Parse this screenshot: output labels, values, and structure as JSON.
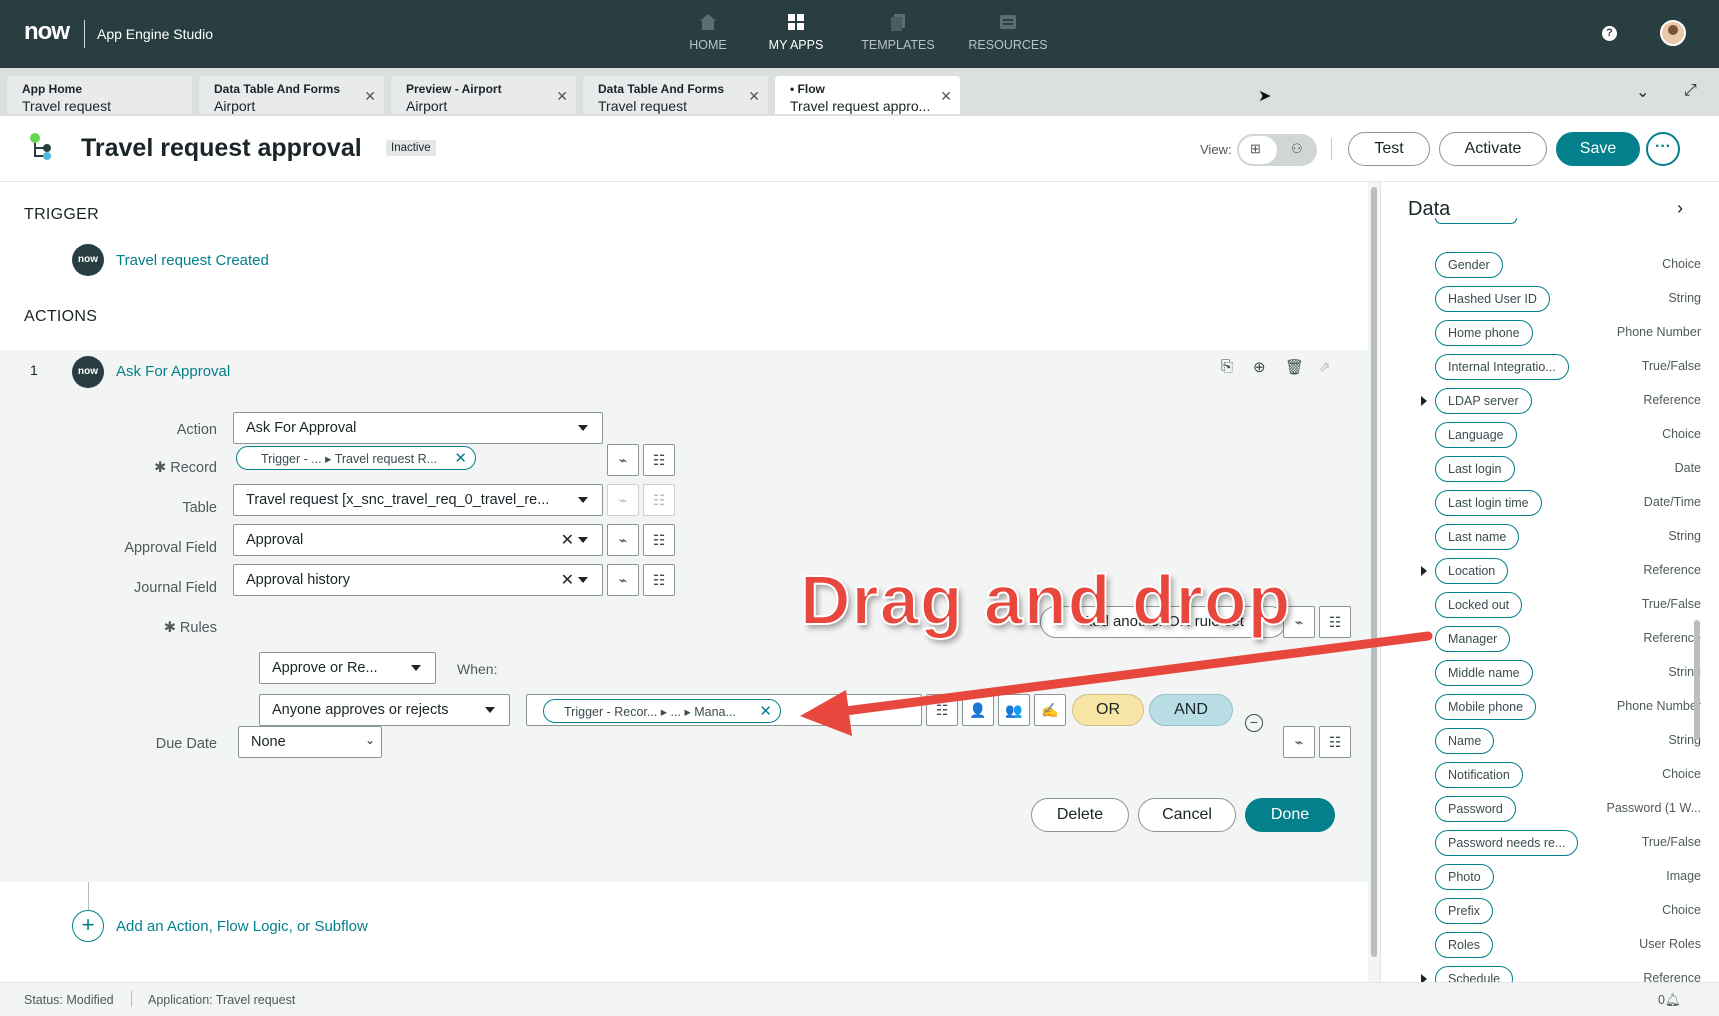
{
  "topnav": {
    "logo": "now",
    "app_title": "App Engine Studio",
    "items": [
      {
        "label": "HOME",
        "icon": "home-icon"
      },
      {
        "label": "MY APPS",
        "icon": "grid-icon"
      },
      {
        "label": "TEMPLATES",
        "icon": "templates-icon"
      },
      {
        "label": "RESOURCES",
        "icon": "resources-icon"
      }
    ],
    "active": "MY APPS",
    "help_glyph": "?"
  },
  "tabs": [
    {
      "line1": "App Home",
      "line2": "Travel request",
      "closable": false
    },
    {
      "line1": "Data Table And Forms",
      "line2": "Airport",
      "closable": true
    },
    {
      "line1": "Preview - Airport",
      "line2": "Airport",
      "closable": true
    },
    {
      "line1": "Data Table And Forms",
      "line2": "Travel request",
      "closable": true
    },
    {
      "line1": "• Flow",
      "line2": "Travel request appro...",
      "closable": true,
      "active": true
    }
  ],
  "header": {
    "title": "Travel request approval",
    "status": "Inactive",
    "view_label": "View:",
    "test_label": "Test",
    "activate_label": "Activate",
    "save_label": "Save",
    "more_label": "···"
  },
  "trigger": {
    "heading": "TRIGGER",
    "badge": "now",
    "label": "Travel request Created"
  },
  "actions": {
    "heading": "ACTIONS",
    "number": "1",
    "badge": "now",
    "title": "Ask For Approval",
    "fields": {
      "action_label": "Action",
      "action_value": "Ask For Approval",
      "record_label": "✱ Record",
      "record_pill_a": "Trigger - ...",
      "record_pill_b": "Travel request R...",
      "table_label": "Table",
      "table_value": "Travel request [x_snc_travel_req_0_travel_re...",
      "approval_field_label": "Approval Field",
      "approval_field_value": "Approval",
      "journal_field_label": "Journal Field",
      "journal_field_value": "Approval history",
      "rules_label": "✱ Rules",
      "rule_type": "Approve or Re...",
      "when_label": "When:",
      "rule_condition": "Anyone approves or rejects",
      "rule_pill_a": "Trigger - Recor...",
      "rule_pill_b": "...",
      "rule_pill_c": "Mana...",
      "or_label": "OR",
      "and_label": "AND",
      "add_or_rule_set": "Add another OR rule set",
      "due_date_label": "Due Date",
      "due_date_value": "None"
    },
    "buttons": {
      "delete": "Delete",
      "cancel": "Cancel",
      "done": "Done"
    },
    "add_action_label": "Add an Action, Flow Logic, or Subflow"
  },
  "data_panel": {
    "title": "Data",
    "items": [
      {
        "name": "Gender",
        "type": "Choice",
        "expandable": false
      },
      {
        "name": "Hashed User ID",
        "type": "String",
        "expandable": false
      },
      {
        "name": "Home phone",
        "type": "Phone Number",
        "expandable": false
      },
      {
        "name": "Internal Integratio...",
        "type": "True/False",
        "expandable": false
      },
      {
        "name": "LDAP server",
        "type": "Reference",
        "expandable": true
      },
      {
        "name": "Language",
        "type": "Choice",
        "expandable": false
      },
      {
        "name": "Last login",
        "type": "Date",
        "expandable": false
      },
      {
        "name": "Last login time",
        "type": "Date/Time",
        "expandable": false
      },
      {
        "name": "Last name",
        "type": "String",
        "expandable": false
      },
      {
        "name": "Location",
        "type": "Reference",
        "expandable": true
      },
      {
        "name": "Locked out",
        "type": "True/False",
        "expandable": false
      },
      {
        "name": "Manager",
        "type": "Reference",
        "expandable": false
      },
      {
        "name": "Middle name",
        "type": "String",
        "expandable": false
      },
      {
        "name": "Mobile phone",
        "type": "Phone Number",
        "expandable": false
      },
      {
        "name": "Name",
        "type": "String",
        "expandable": false
      },
      {
        "name": "Notification",
        "type": "Choice",
        "expandable": false
      },
      {
        "name": "Password",
        "type": "Password (1 W...",
        "expandable": false
      },
      {
        "name": "Password needs re...",
        "type": "True/False",
        "expandable": false
      },
      {
        "name": "Photo",
        "type": "Image",
        "expandable": false
      },
      {
        "name": "Prefix",
        "type": "Choice",
        "expandable": false
      },
      {
        "name": "Roles",
        "type": "User Roles",
        "expandable": false
      },
      {
        "name": "Schedule",
        "type": "Reference",
        "expandable": true
      }
    ]
  },
  "statusbar": {
    "status": "Status: Modified",
    "application": "Application: Travel request",
    "notifications": "0"
  },
  "annotation": {
    "text": "Drag and drop",
    "color": "#e8473e"
  },
  "colors": {
    "nav_bg": "#293e40",
    "accent": "#047f8c",
    "or_bg": "#f7e5a6",
    "and_bg": "#b9dde4"
  }
}
